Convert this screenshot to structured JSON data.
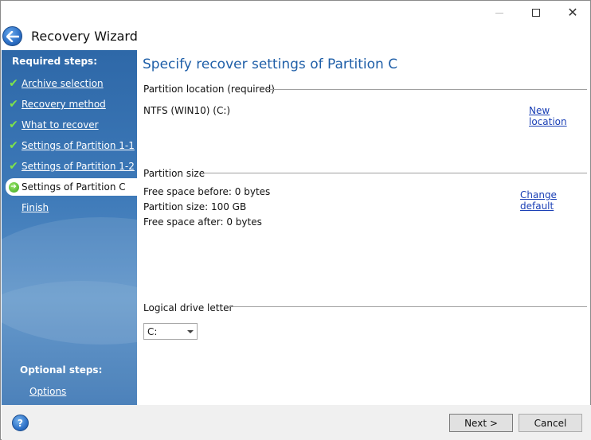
{
  "window": {
    "title": "Recovery Wizard",
    "controls": {
      "minimize_icon": "minimize-icon",
      "maximize_icon": "maximize-icon",
      "close_icon": "close-icon"
    }
  },
  "sidebar": {
    "required_heading": "Required steps:",
    "items": [
      {
        "label": "Archive selection",
        "state": "done"
      },
      {
        "label": "Recovery method",
        "state": "done"
      },
      {
        "label": "What to recover",
        "state": "done"
      },
      {
        "label": "Settings of Partition 1-1",
        "state": "done"
      },
      {
        "label": "Settings of Partition 1-2",
        "state": "done"
      },
      {
        "label": "Settings of Partition C",
        "state": "current"
      },
      {
        "label": "Finish",
        "state": "pending"
      }
    ],
    "optional_heading": "Optional steps:",
    "optional_items": [
      {
        "label": "Options"
      }
    ]
  },
  "main": {
    "title": "Specify recover settings of Partition C",
    "location": {
      "heading": "Partition location (required)",
      "value": "NTFS (WIN10) (C:)",
      "link": "New location"
    },
    "size": {
      "heading": "Partition size",
      "free_before": "Free space before: 0 bytes",
      "partition_size": "Partition size: 100 GB",
      "free_after": "Free space after: 0 bytes",
      "link": "Change default"
    },
    "drive_letter": {
      "heading": "Logical drive letter",
      "selected": "C:"
    }
  },
  "footer": {
    "help": "?",
    "next_label": "Next >",
    "cancel_label": "Cancel"
  },
  "colors": {
    "accent": "#1f5fa8",
    "sidebar": "#3d79b8",
    "check": "#7fe34a",
    "link": "#1a3fb5"
  }
}
